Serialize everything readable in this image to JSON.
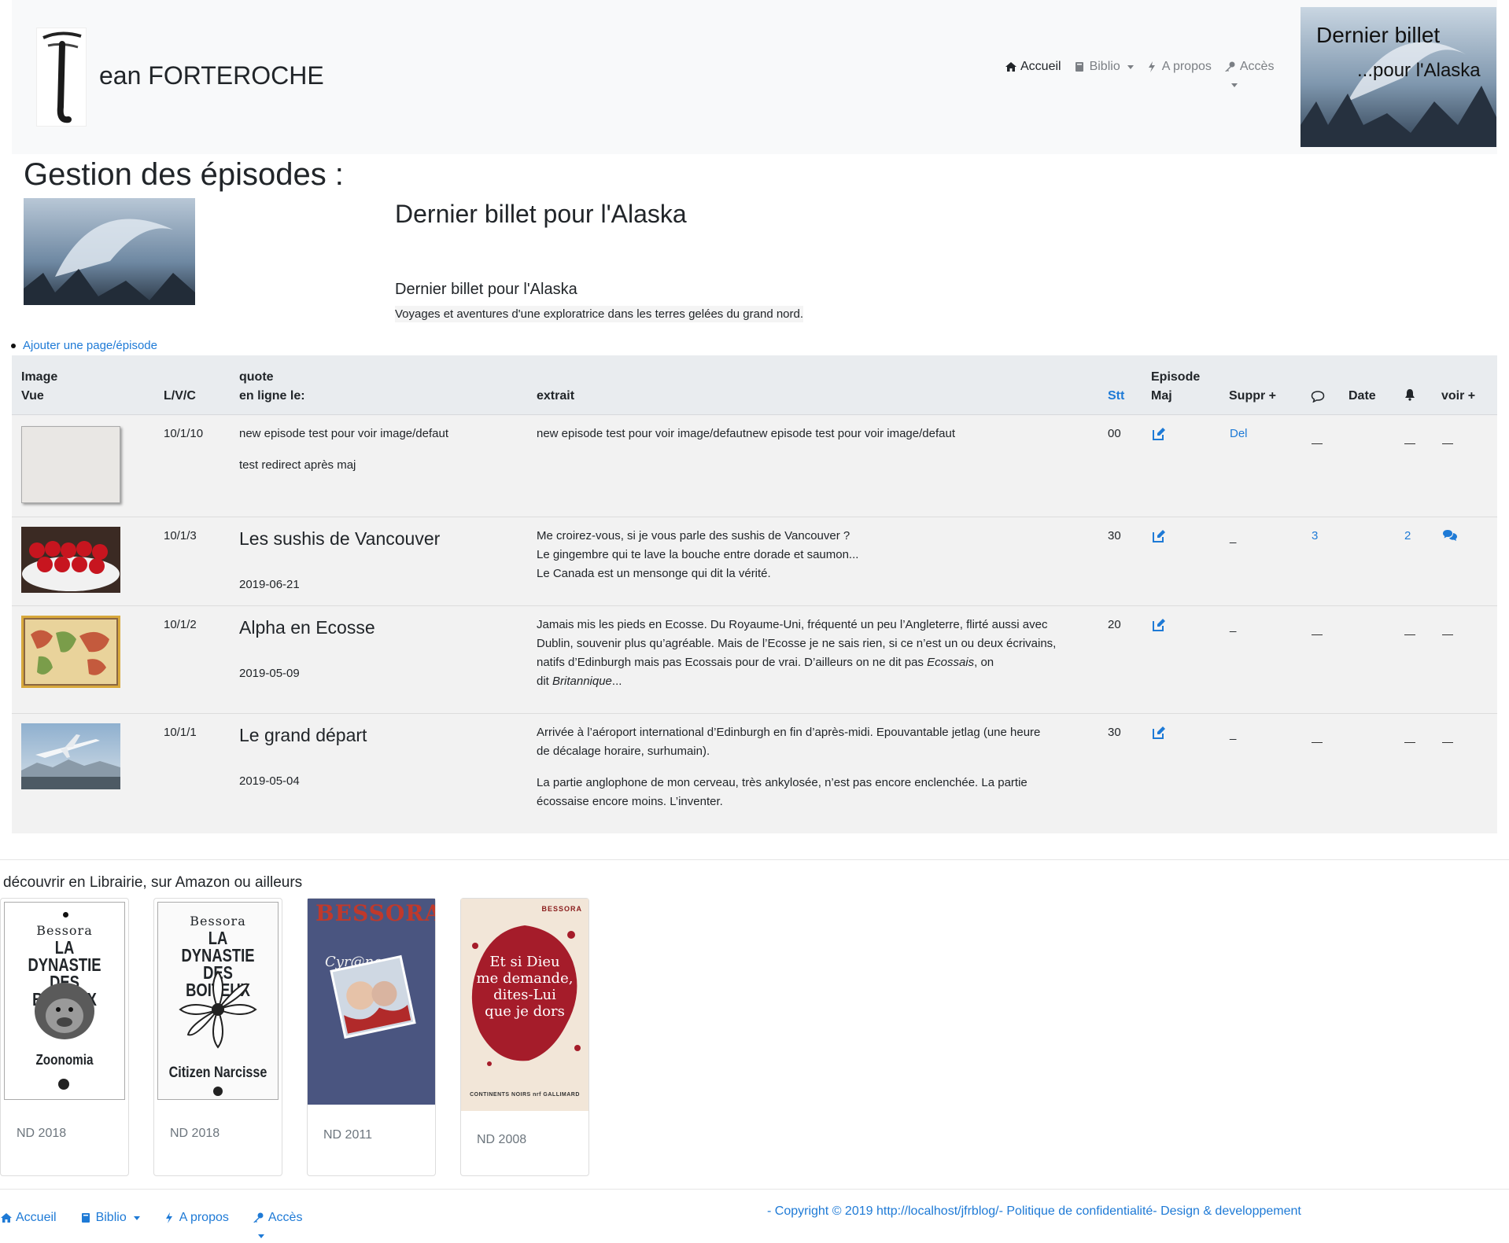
{
  "brand": {
    "name": "ean FORTEROCHE"
  },
  "nav": {
    "items": [
      {
        "label": "Accueil",
        "icon": "home-icon"
      },
      {
        "label": "Biblio",
        "icon": "book-icon"
      },
      {
        "label": "A propos",
        "icon": "bolt-icon"
      },
      {
        "label": "Accès",
        "icon": "key-icon"
      }
    ]
  },
  "hero": {
    "line1": "Dernier billet",
    "line2": "...pour l'Alaska"
  },
  "page": {
    "title": "Gestion des épisodes :"
  },
  "story": {
    "title": "Dernier billet pour l'Alaska",
    "subtitle": "Dernier billet pour l'Alaska",
    "description": "Voyages et aventures d'une exploratrice dans les terres gelées du grand nord."
  },
  "actions": {
    "add": "Ajouter une page/épisode"
  },
  "table": {
    "headers": {
      "image": "Image",
      "vue": "Vue",
      "lvc": "L/V/C",
      "quote": "quote",
      "online": "en ligne le:",
      "extrait": "extrait",
      "stt": "Stt",
      "episode": "Episode",
      "maj": "Maj",
      "suppr": "Suppr +",
      "date": "Date",
      "voir": "voir +"
    },
    "rows": [
      {
        "lvc": "10/1/10",
        "quote": "new episode test pour voir image/defaut",
        "quote2": "test redirect après maj",
        "extrait": "new episode test pour voir image/defautnew episode test pour voir image/defaut",
        "stt": "00",
        "suppr": "Del"
      },
      {
        "lvc": "10/1/3",
        "title": "Les sushis de Vancouver",
        "date": "2019-06-21",
        "extrait": [
          "Me croirez-vous, si je vous parle des sushis de Vancouver ?",
          "Le gingembre qui te lave la bouche entre dorade et saumon...",
          "Le Canada est un mensonge qui dit la vérité."
        ],
        "stt": "30",
        "suppr": "_",
        "comments": "3",
        "alerts": "2"
      },
      {
        "lvc": "10/1/2",
        "title": "Alpha en Ecosse",
        "date": "2019-05-09",
        "extrait": [
          "Jamais mis les pieds en Ecosse. Du Royaume-Uni, fréquenté un peu l’Angleterre, flirté aussi avec",
          "Dublin, souvenir plus qu’agréable. Mais de l’Ecosse je ne sais rien, si ce n’est un ou deux écrivains,",
          "natifs d’Edinburgh mais pas Ecossais pour de vrai. D’ailleurs on ne dit pas ",
          "Ecossais",
          ", on",
          "dit ",
          "Britannique",
          "..."
        ],
        "stt": "20",
        "suppr": "_"
      },
      {
        "lvc": "10/1/1",
        "title": "Le grand départ",
        "date": "2019-05-04",
        "extrait": [
          "Arrivée à l’aéroport international d’Edinburgh en fin d’après-midi. Epouvantable jetlag (une heure",
          "de décalage horaire, surhumain).",
          "La partie anglophone de mon cerveau, très ankylosée, n’est pas encore enclenchée. La partie",
          "écossaise encore moins. L’inventer."
        ],
        "stt": "30",
        "suppr": "_"
      }
    ]
  },
  "books": {
    "title": "découvrir en Librairie, sur Amazon ou ailleurs",
    "items": [
      {
        "caption": "ND 2018",
        "author": "Bessora",
        "title1": "LA DYNASTIE",
        "title2": "DES BOITEUX",
        "subtitle": "Zoonomia"
      },
      {
        "caption": "ND 2018",
        "author": "Bessora",
        "title1": "LA DYNASTIE",
        "title2": "DES BOITEUX",
        "subtitle": "Citizen Narcisse"
      },
      {
        "caption": "ND 2011",
        "author": "BESSORA",
        "subtitle": "Cyr@no"
      },
      {
        "caption": "ND 2008",
        "author": "BESSORA",
        "title1": "Et si Dieu",
        "title2": "me demande,",
        "title3": "dites-Lui",
        "title4": "que je dors",
        "publisher": "CONTINENTS NOIRS  nrf  GALLIMARD"
      }
    ]
  },
  "footer": {
    "copyright": "- Copyright © 2019 http://localhost/jfrblog/- Politique de confidentialité- Design & developpement"
  },
  "colors": {
    "link": "#1e7ad6",
    "header_bg": "#f8f9fa",
    "table_bg": "#f2f2f2",
    "thead_bg": "#e9ecef"
  }
}
